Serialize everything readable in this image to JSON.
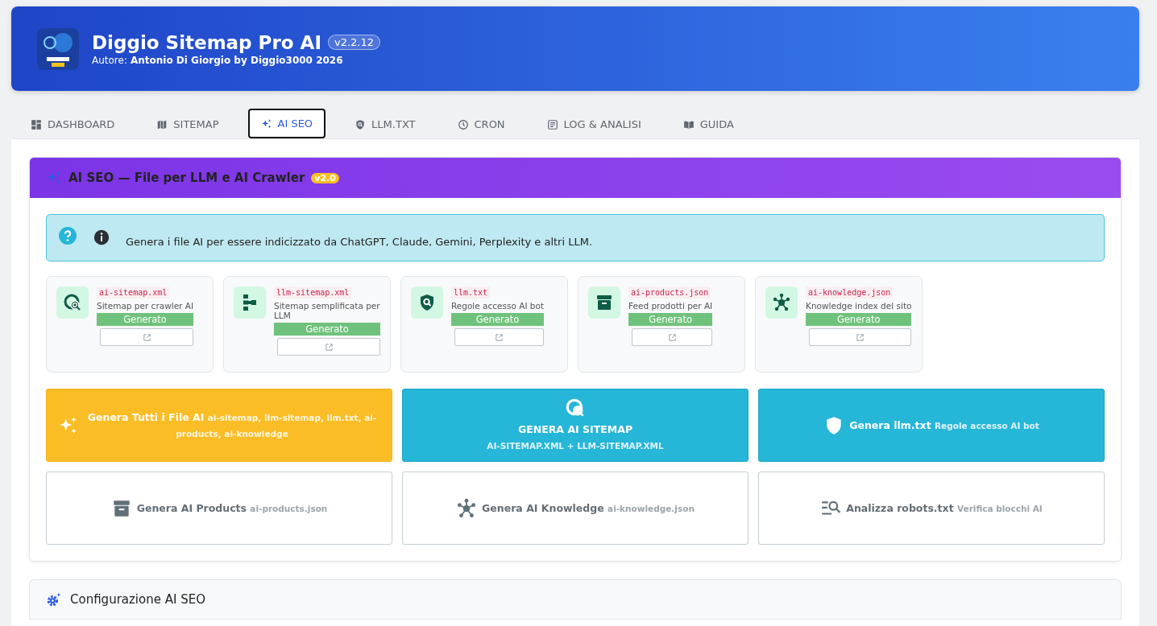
{
  "header": {
    "title": "Diggio Sitemap Pro AI",
    "version": "v2.2.12",
    "author_label": "Autore:",
    "author": "Antonio Di Giorgio by Diggio3000 2026"
  },
  "tabs": [
    {
      "label": "DASHBOARD",
      "selected": false
    },
    {
      "label": "SITEMAP",
      "selected": false
    },
    {
      "label": "AI SEO",
      "selected": true
    },
    {
      "label": "LLM.TXT",
      "selected": false
    },
    {
      "label": "CRON",
      "selected": false
    },
    {
      "label": "LOG & ANALISI",
      "selected": false
    },
    {
      "label": "GUIDA",
      "selected": false
    }
  ],
  "ai_seo_card": {
    "title": "AI SEO — File per LLM e AI Crawler",
    "badge": "v2.0",
    "info": "Genera i file AI per essere indicizzato da ChatGPT, Claude, Gemini, Perplexity e altri LLM.",
    "files": [
      {
        "name": "ai-sitemap.xml",
        "description": "Sitemap per crawler AI",
        "status": "Generato"
      },
      {
        "name": "llm-sitemap.xml",
        "description": "Sitemap semplificata per LLM",
        "status": "Generato"
      },
      {
        "name": "llm.txt",
        "description": "Regole accesso AI bot",
        "status": "Generato"
      },
      {
        "name": "ai-products.json",
        "description": "Feed prodotti per AI",
        "status": "Generato"
      },
      {
        "name": "ai-knowledge.json",
        "description": "Knowledge index del sito",
        "status": "Generato"
      }
    ],
    "actions": [
      {
        "kind": "warning",
        "label": "Genera Tutti i File AI",
        "detail": "ai-sitemap, llm-sitemap, llm.txt, ai-products, ai-knowledge"
      },
      {
        "kind": "info-stacked",
        "label": "GENERA AI SITEMAP",
        "detail": "AI-SITEMAP.XML + LLM-SITEMAP.XML"
      },
      {
        "kind": "info",
        "label": "Genera llm.txt",
        "detail": "Regole accesso AI bot"
      },
      {
        "kind": "outline",
        "label": "Genera AI Products",
        "detail": "ai-products.json"
      },
      {
        "kind": "outline",
        "label": "Genera AI Knowledge",
        "detail": "ai-knowledge.json"
      },
      {
        "kind": "outline",
        "label": "Analizza robots.txt",
        "detail": "Verifica blocchi AI"
      }
    ]
  },
  "config_card": {
    "title": "Configurazione AI SEO"
  }
}
